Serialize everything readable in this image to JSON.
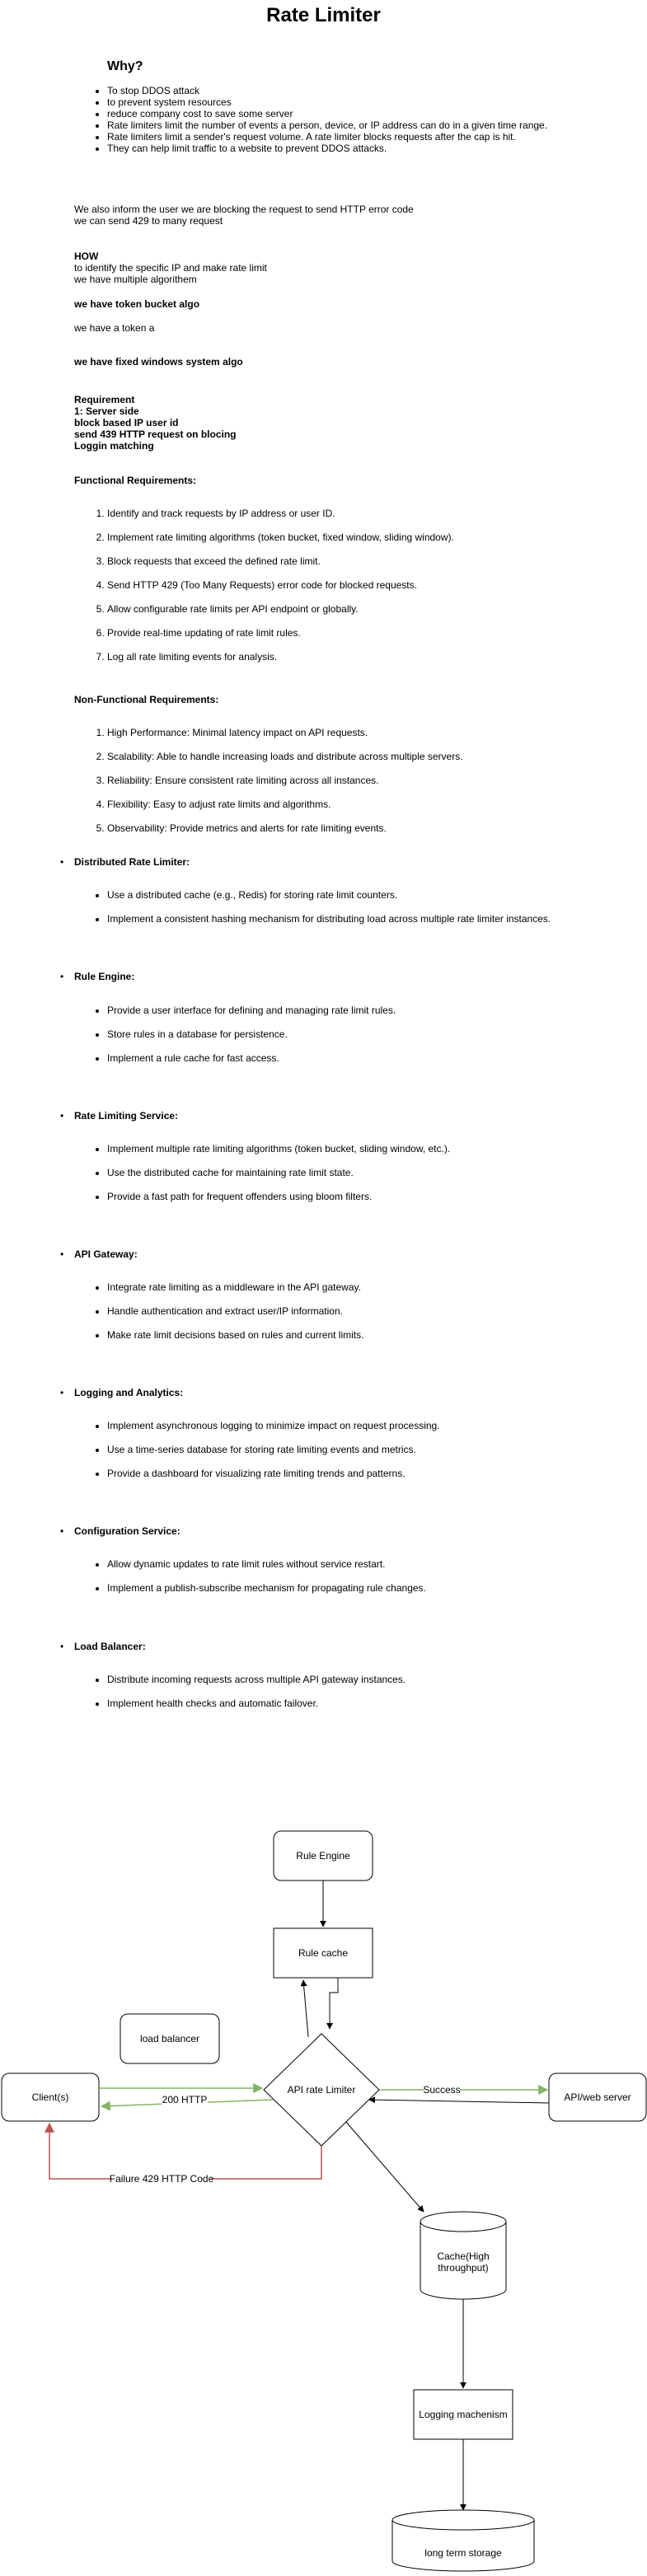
{
  "title": "Rate Limiter",
  "why": {
    "heading": "Why?",
    "items": [
      "To stop DDOS attack",
      "to prevent system resources",
      "reduce company cost to save some server",
      "Rate limiters limit the number of events a person, device, or IP address can do in a given time range.",
      "Rate limiters limit a sender's request volume. A rate limiter blocks requests after the cap is hit.",
      " They can help limit traffic to a website to prevent DDOS attacks."
    ]
  },
  "notes": {
    "inform_line1": "We also inform the user we are blocking the request to send HTTP error code",
    "inform_line2": "we can send 429 to many request",
    "how_heading": "HOW",
    "how_line1": "to identify the specific IP and make rate limit",
    "how_line2": "we have multiple algorithem",
    "token_bucket": "we have token bucket algo",
    "token_a": "we have a token a",
    "fixed_window": "we have fixed windows system algo",
    "requirement_heading": " Requirement",
    "req_lines": [
      "1: Server side",
      "block based IP user id",
      "send 439 HTTP request on blocing",
      "Loggin matching"
    ]
  },
  "functional": {
    "heading": "Functional Requirements:",
    "items": [
      "Identify and track requests by IP address or user ID.",
      "Implement rate limiting algorithms (token bucket, fixed window, sliding window).",
      "Block requests that exceed the defined rate limit.",
      "Send HTTP 429 (Too Many Requests) error code for blocked requests.",
      "Allow configurable rate limits per API endpoint or globally.",
      "Provide real-time updating of rate limit rules.",
      "Log all rate limiting events for analysis."
    ]
  },
  "nonfunctional": {
    "heading": "Non-Functional Requirements:",
    "items": [
      "High Performance: Minimal latency impact on API requests.",
      "Scalability: Able to handle increasing loads and distribute across multiple servers.",
      "Reliability: Ensure consistent rate limiting across all instances.",
      "Flexibility: Easy to adjust rate limits and algorithms.",
      "Observability: Provide metrics and alerts for rate limiting events."
    ]
  },
  "sections": [
    {
      "title": "Distributed Rate Limiter:",
      "items": [
        "Use a distributed cache (e.g., Redis) for storing rate limit counters.",
        "Implement a consistent hashing mechanism for distributing load across multiple rate limiter instances."
      ]
    },
    {
      "title": "Rule Engine:",
      "items": [
        "Provide a user interface for defining and managing rate limit rules.",
        "Store rules in a database for persistence.",
        "Implement a rule cache for fast access."
      ]
    },
    {
      "title": "Rate Limiting Service:",
      "items": [
        "Implement multiple rate limiting algorithms (token bucket, sliding window, etc.).",
        "Use the distributed cache for maintaining rate limit state.",
        "Provide a fast path for frequent offenders using bloom filters."
      ]
    },
    {
      "title": "API Gateway:",
      "items": [
        "Integrate rate limiting as a middleware in the API gateway.",
        "Handle authentication and extract user/IP information.",
        "Make rate limit decisions based on rules and current limits."
      ]
    },
    {
      "title": "Logging and Analytics:",
      "items": [
        "Implement asynchronous logging to minimize impact on request processing.",
        "Use a time-series database for storing rate limiting events and metrics.",
        "Provide a dashboard for visualizing rate limiting trends and patterns."
      ]
    },
    {
      "title": "Configuration Service:",
      "items": [
        "Allow dynamic updates to rate limit rules without service restart.",
        "Implement a publish-subscribe mechanism for propagating rule changes."
      ]
    },
    {
      "title": "Load Balancer:",
      "items": [
        "Distribute incoming requests across multiple API gateway instances.",
        "Implement health checks and automatic failover."
      ]
    }
  ],
  "diagram": {
    "rule_engine": "Rule Engine",
    "rule_cache": "Rule cache",
    "load_balancer": "load balancer",
    "clients": "Client(s)",
    "rate_limiter": "API rate Limiter",
    "api_server": "API/web server",
    "success": "Success",
    "http200": "200 HTTP",
    "failure": "Failure 429 HTTP Code",
    "cache_line1": "Cache(High",
    "cache_line2": "throughput)",
    "logging": "Logging machenism",
    "storage": "long term storage",
    "colors": {
      "green": "#82b366",
      "red": "#b85450",
      "stroke": "#000000"
    }
  }
}
